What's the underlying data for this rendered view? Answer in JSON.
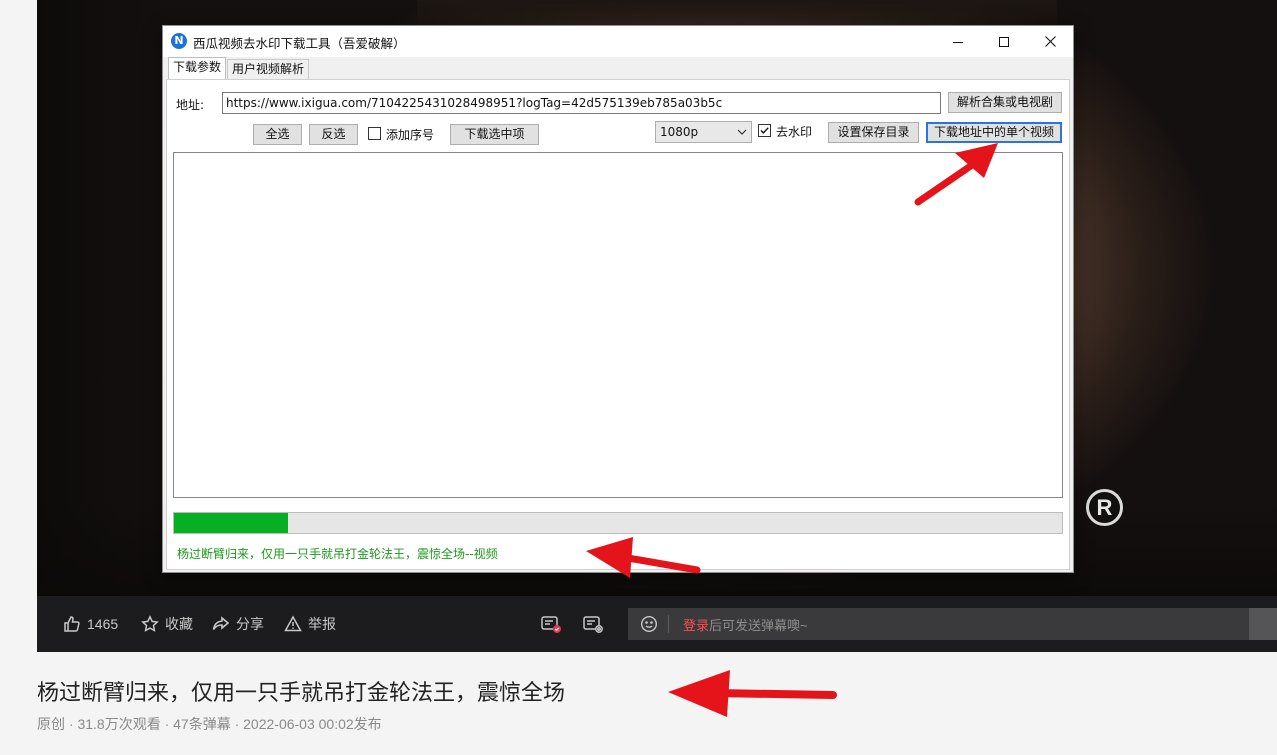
{
  "app": {
    "title": "西瓜视频去水印下载工具（吾爱破解）",
    "icon_letter": "N",
    "tabs": [
      "下载参数",
      "用户视频解析"
    ],
    "url_label": "地址:",
    "url_value": "https://www.ixigua.com/7104225431028498951?logTag=42d575139eb785a03b5c",
    "parse_button": "解析合集或电视剧",
    "select_all": "全选",
    "invert_select": "反选",
    "add_index_label": "添加序号",
    "add_index_checked": false,
    "download_selected": "下载选中项",
    "quality": "1080p",
    "remove_watermark_label": "去水印",
    "remove_watermark_checked": true,
    "save_dir_button": "设置保存目录",
    "download_single_button": "下载地址中的单个视频",
    "progress_fraction": 0.128,
    "status_text": "杨过断臂归来，仅用一只手就吊打金轮法王，震惊全场--视频"
  },
  "player": {
    "likes": "1465",
    "favorite": "收藏",
    "share": "分享",
    "report": "举报",
    "danmu_login": "登录",
    "danmu_placeholder": "后可发送弹幕噢~"
  },
  "video": {
    "title": "杨过断臂归来，仅用一只手就吊打金轮法王，震惊全场",
    "meta": "原创 · 31.8万次观看 · 47条弹幕 · 2022-06-03 00:02发布",
    "watermark": "R"
  },
  "colors": {
    "progress": "#06b025",
    "status_text": "#1b9a1b",
    "annotation_arrow": "#e5141b",
    "login_link": "#ff4d4f"
  }
}
